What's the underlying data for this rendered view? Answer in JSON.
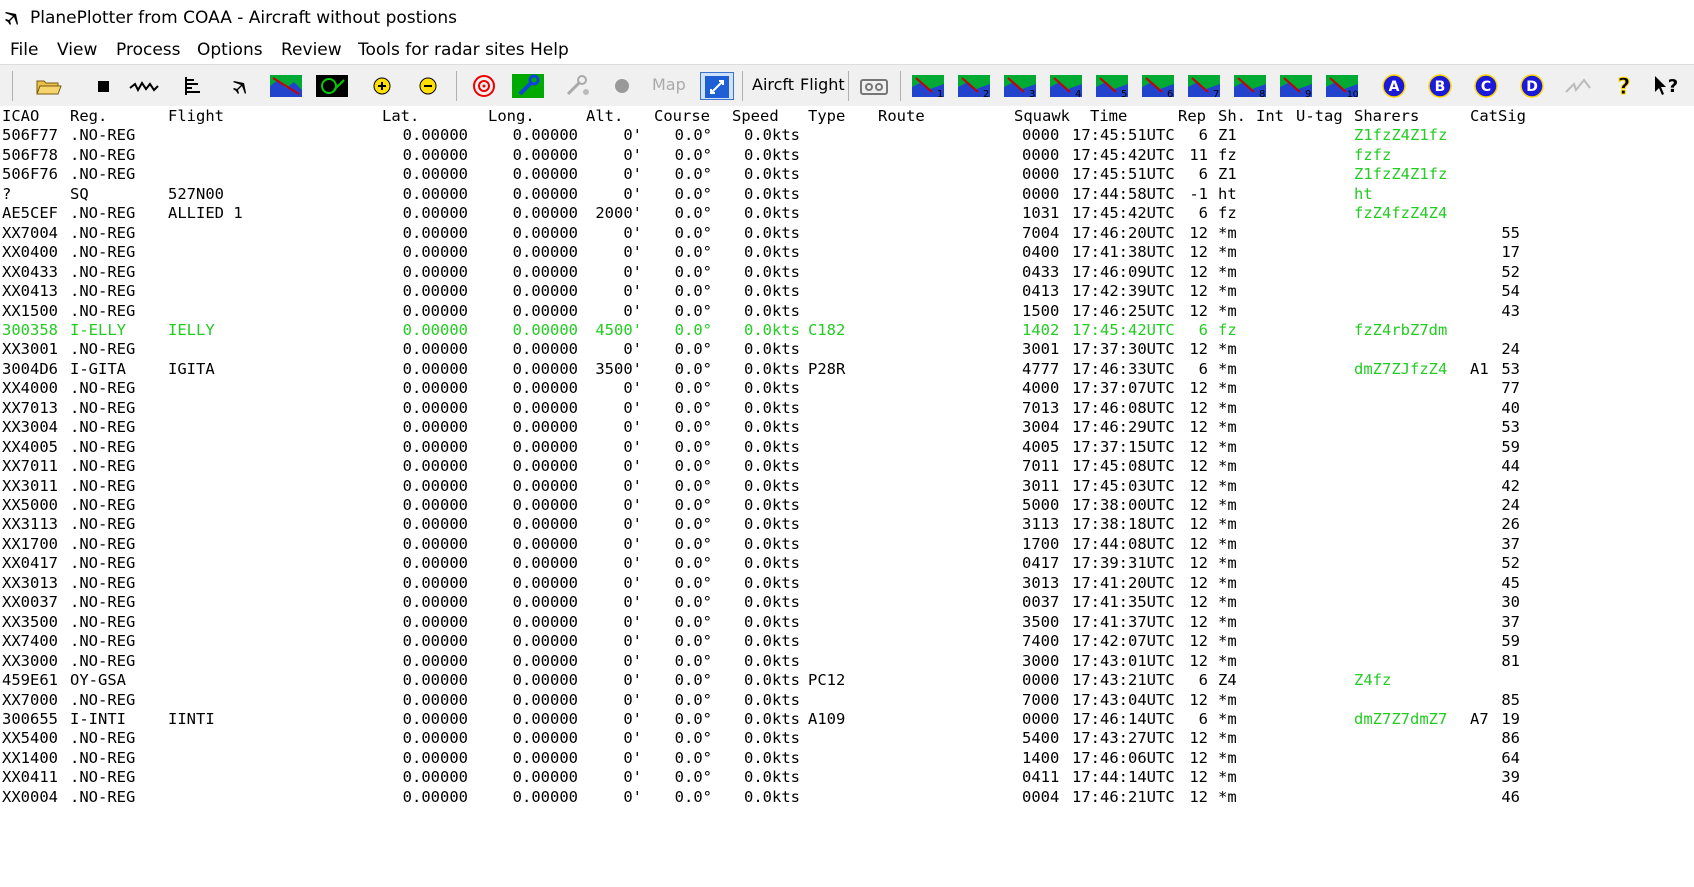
{
  "window": {
    "title": "PlanePlotter from COAA - Aircraft without postions"
  },
  "menu": [
    "File",
    "View",
    "Process",
    "Options",
    "Review",
    "Tools for radar sites",
    "Help"
  ],
  "toolbar": {
    "aircraft_label": "Aircft",
    "flight_label": "Flight",
    "map_label": "Map",
    "chart_numbers": [
      "1",
      "2",
      "3",
      "4",
      "5",
      "6",
      "7",
      "8",
      "9",
      "10"
    ],
    "letter_buttons": [
      "A",
      "B",
      "C",
      "D"
    ],
    "help_label": "?"
  },
  "columns": [
    "ICAO",
    "Reg.",
    "Flight",
    "Lat.",
    "Long.",
    "Alt.",
    "Course",
    "Speed",
    "Type",
    "Route",
    "Squawk",
    "Time",
    "Rep",
    "Sh.",
    "Int",
    "U-tag",
    "Sharers",
    "Cat",
    "Sig"
  ],
  "rows": [
    {
      "icao": "506F77",
      "reg": ".NO-REG",
      "flight": "",
      "lat": "0.00000",
      "lon": "0.00000",
      "alt": "0'",
      "course": "0.0°",
      "speed": "0.0kts",
      "type": "",
      "squawk": "0000",
      "time": "17:45:51UTC",
      "rep": "6",
      "sh": "Z1",
      "sharers": "Z1fzZ4Z1fz",
      "cat": "",
      "sig": "",
      "hl": false
    },
    {
      "icao": "506F78",
      "reg": ".NO-REG",
      "flight": "",
      "lat": "0.00000",
      "lon": "0.00000",
      "alt": "0'",
      "course": "0.0°",
      "speed": "0.0kts",
      "type": "",
      "squawk": "0000",
      "time": "17:45:42UTC",
      "rep": "11",
      "sh": "fz",
      "sharers": "fzfz",
      "cat": "",
      "sig": "",
      "hl": false
    },
    {
      "icao": "506F76",
      "reg": ".NO-REG",
      "flight": "",
      "lat": "0.00000",
      "lon": "0.00000",
      "alt": "0'",
      "course": "0.0°",
      "speed": "0.0kts",
      "type": "",
      "squawk": "0000",
      "time": "17:45:51UTC",
      "rep": "6",
      "sh": "Z1",
      "sharers": "Z1fzZ4Z1fz",
      "cat": "",
      "sig": "",
      "hl": false
    },
    {
      "icao": "?",
      "reg": "SQ",
      "flight": "527N00",
      "lat": "0.00000",
      "lon": "0.00000",
      "alt": "0'",
      "course": "0.0°",
      "speed": "0.0kts",
      "type": "",
      "squawk": "0000",
      "time": "17:44:58UTC",
      "rep": "-1",
      "sh": "ht",
      "sharers": "ht",
      "cat": "",
      "sig": "",
      "hl": false
    },
    {
      "icao": "AE5CEF",
      "reg": ".NO-REG",
      "flight": "ALLIED 1",
      "lat": "0.00000",
      "lon": "0.00000",
      "alt": "2000'",
      "course": "0.0°",
      "speed": "0.0kts",
      "type": "",
      "squawk": "1031",
      "time": "17:45:42UTC",
      "rep": "6",
      "sh": "fz",
      "sharers": "fzZ4fzZ4Z4",
      "cat": "",
      "sig": "",
      "hl": false
    },
    {
      "icao": "XX7004",
      "reg": ".NO-REG",
      "flight": "",
      "lat": "0.00000",
      "lon": "0.00000",
      "alt": "0'",
      "course": "0.0°",
      "speed": "0.0kts",
      "type": "",
      "squawk": "7004",
      "time": "17:46:20UTC",
      "rep": "12",
      "sh": "*m",
      "sharers": "",
      "cat": "",
      "sig": "55",
      "hl": false
    },
    {
      "icao": "XX0400",
      "reg": ".NO-REG",
      "flight": "",
      "lat": "0.00000",
      "lon": "0.00000",
      "alt": "0'",
      "course": "0.0°",
      "speed": "0.0kts",
      "type": "",
      "squawk": "0400",
      "time": "17:41:38UTC",
      "rep": "12",
      "sh": "*m",
      "sharers": "",
      "cat": "",
      "sig": "17",
      "hl": false
    },
    {
      "icao": "XX0433",
      "reg": ".NO-REG",
      "flight": "",
      "lat": "0.00000",
      "lon": "0.00000",
      "alt": "0'",
      "course": "0.0°",
      "speed": "0.0kts",
      "type": "",
      "squawk": "0433",
      "time": "17:46:09UTC",
      "rep": "12",
      "sh": "*m",
      "sharers": "",
      "cat": "",
      "sig": "52",
      "hl": false
    },
    {
      "icao": "XX0413",
      "reg": ".NO-REG",
      "flight": "",
      "lat": "0.00000",
      "lon": "0.00000",
      "alt": "0'",
      "course": "0.0°",
      "speed": "0.0kts",
      "type": "",
      "squawk": "0413",
      "time": "17:42:39UTC",
      "rep": "12",
      "sh": "*m",
      "sharers": "",
      "cat": "",
      "sig": "54",
      "hl": false
    },
    {
      "icao": "XX1500",
      "reg": ".NO-REG",
      "flight": "",
      "lat": "0.00000",
      "lon": "0.00000",
      "alt": "0'",
      "course": "0.0°",
      "speed": "0.0kts",
      "type": "",
      "squawk": "1500",
      "time": "17:46:25UTC",
      "rep": "12",
      "sh": "*m",
      "sharers": "",
      "cat": "",
      "sig": "43",
      "hl": false
    },
    {
      "icao": "300358",
      "reg": "I-ELLY",
      "flight": "IELLY",
      "lat": "0.00000",
      "lon": "0.00000",
      "alt": "4500'",
      "course": "0.0°",
      "speed": "0.0kts",
      "type": "C182",
      "squawk": "1402",
      "time": "17:45:42UTC",
      "rep": "6",
      "sh": "fz",
      "sharers": "fzZ4rbZ7dm",
      "cat": "",
      "sig": "",
      "hl": true
    },
    {
      "icao": "XX3001",
      "reg": ".NO-REG",
      "flight": "",
      "lat": "0.00000",
      "lon": "0.00000",
      "alt": "0'",
      "course": "0.0°",
      "speed": "0.0kts",
      "type": "",
      "squawk": "3001",
      "time": "17:37:30UTC",
      "rep": "12",
      "sh": "*m",
      "sharers": "",
      "cat": "",
      "sig": "24",
      "hl": false
    },
    {
      "icao": "3004D6",
      "reg": "I-GITA",
      "flight": "IGITA",
      "lat": "0.00000",
      "lon": "0.00000",
      "alt": "3500'",
      "course": "0.0°",
      "speed": "0.0kts",
      "type": "P28R",
      "squawk": "4777",
      "time": "17:46:33UTC",
      "rep": "6",
      "sh": "*m",
      "sharers": "dmZ7ZJfzZ4",
      "cat": "A1",
      "sig": "53",
      "hl": false
    },
    {
      "icao": "XX4000",
      "reg": ".NO-REG",
      "flight": "",
      "lat": "0.00000",
      "lon": "0.00000",
      "alt": "0'",
      "course": "0.0°",
      "speed": "0.0kts",
      "type": "",
      "squawk": "4000",
      "time": "17:37:07UTC",
      "rep": "12",
      "sh": "*m",
      "sharers": "",
      "cat": "",
      "sig": "77",
      "hl": false
    },
    {
      "icao": "XX7013",
      "reg": ".NO-REG",
      "flight": "",
      "lat": "0.00000",
      "lon": "0.00000",
      "alt": "0'",
      "course": "0.0°",
      "speed": "0.0kts",
      "type": "",
      "squawk": "7013",
      "time": "17:46:08UTC",
      "rep": "12",
      "sh": "*m",
      "sharers": "",
      "cat": "",
      "sig": "40",
      "hl": false
    },
    {
      "icao": "XX3004",
      "reg": ".NO-REG",
      "flight": "",
      "lat": "0.00000",
      "lon": "0.00000",
      "alt": "0'",
      "course": "0.0°",
      "speed": "0.0kts",
      "type": "",
      "squawk": "3004",
      "time": "17:46:29UTC",
      "rep": "12",
      "sh": "*m",
      "sharers": "",
      "cat": "",
      "sig": "53",
      "hl": false
    },
    {
      "icao": "XX4005",
      "reg": ".NO-REG",
      "flight": "",
      "lat": "0.00000",
      "lon": "0.00000",
      "alt": "0'",
      "course": "0.0°",
      "speed": "0.0kts",
      "type": "",
      "squawk": "4005",
      "time": "17:37:15UTC",
      "rep": "12",
      "sh": "*m",
      "sharers": "",
      "cat": "",
      "sig": "59",
      "hl": false
    },
    {
      "icao": "XX7011",
      "reg": ".NO-REG",
      "flight": "",
      "lat": "0.00000",
      "lon": "0.00000",
      "alt": "0'",
      "course": "0.0°",
      "speed": "0.0kts",
      "type": "",
      "squawk": "7011",
      "time": "17:45:08UTC",
      "rep": "12",
      "sh": "*m",
      "sharers": "",
      "cat": "",
      "sig": "44",
      "hl": false
    },
    {
      "icao": "XX3011",
      "reg": ".NO-REG",
      "flight": "",
      "lat": "0.00000",
      "lon": "0.00000",
      "alt": "0'",
      "course": "0.0°",
      "speed": "0.0kts",
      "type": "",
      "squawk": "3011",
      "time": "17:45:03UTC",
      "rep": "12",
      "sh": "*m",
      "sharers": "",
      "cat": "",
      "sig": "42",
      "hl": false
    },
    {
      "icao": "XX5000",
      "reg": ".NO-REG",
      "flight": "",
      "lat": "0.00000",
      "lon": "0.00000",
      "alt": "0'",
      "course": "0.0°",
      "speed": "0.0kts",
      "type": "",
      "squawk": "5000",
      "time": "17:38:00UTC",
      "rep": "12",
      "sh": "*m",
      "sharers": "",
      "cat": "",
      "sig": "24",
      "hl": false
    },
    {
      "icao": "XX3113",
      "reg": ".NO-REG",
      "flight": "",
      "lat": "0.00000",
      "lon": "0.00000",
      "alt": "0'",
      "course": "0.0°",
      "speed": "0.0kts",
      "type": "",
      "squawk": "3113",
      "time": "17:38:18UTC",
      "rep": "12",
      "sh": "*m",
      "sharers": "",
      "cat": "",
      "sig": "26",
      "hl": false
    },
    {
      "icao": "XX1700",
      "reg": ".NO-REG",
      "flight": "",
      "lat": "0.00000",
      "lon": "0.00000",
      "alt": "0'",
      "course": "0.0°",
      "speed": "0.0kts",
      "type": "",
      "squawk": "1700",
      "time": "17:44:08UTC",
      "rep": "12",
      "sh": "*m",
      "sharers": "",
      "cat": "",
      "sig": "37",
      "hl": false
    },
    {
      "icao": "XX0417",
      "reg": ".NO-REG",
      "flight": "",
      "lat": "0.00000",
      "lon": "0.00000",
      "alt": "0'",
      "course": "0.0°",
      "speed": "0.0kts",
      "type": "",
      "squawk": "0417",
      "time": "17:39:31UTC",
      "rep": "12",
      "sh": "*m",
      "sharers": "",
      "cat": "",
      "sig": "52",
      "hl": false
    },
    {
      "icao": "XX3013",
      "reg": ".NO-REG",
      "flight": "",
      "lat": "0.00000",
      "lon": "0.00000",
      "alt": "0'",
      "course": "0.0°",
      "speed": "0.0kts",
      "type": "",
      "squawk": "3013",
      "time": "17:41:20UTC",
      "rep": "12",
      "sh": "*m",
      "sharers": "",
      "cat": "",
      "sig": "45",
      "hl": false
    },
    {
      "icao": "XX0037",
      "reg": ".NO-REG",
      "flight": "",
      "lat": "0.00000",
      "lon": "0.00000",
      "alt": "0'",
      "course": "0.0°",
      "speed": "0.0kts",
      "type": "",
      "squawk": "0037",
      "time": "17:41:35UTC",
      "rep": "12",
      "sh": "*m",
      "sharers": "",
      "cat": "",
      "sig": "30",
      "hl": false
    },
    {
      "icao": "XX3500",
      "reg": ".NO-REG",
      "flight": "",
      "lat": "0.00000",
      "lon": "0.00000",
      "alt": "0'",
      "course": "0.0°",
      "speed": "0.0kts",
      "type": "",
      "squawk": "3500",
      "time": "17:41:37UTC",
      "rep": "12",
      "sh": "*m",
      "sharers": "",
      "cat": "",
      "sig": "37",
      "hl": false
    },
    {
      "icao": "XX7400",
      "reg": ".NO-REG",
      "flight": "",
      "lat": "0.00000",
      "lon": "0.00000",
      "alt": "0'",
      "course": "0.0°",
      "speed": "0.0kts",
      "type": "",
      "squawk": "7400",
      "time": "17:42:07UTC",
      "rep": "12",
      "sh": "*m",
      "sharers": "",
      "cat": "",
      "sig": "59",
      "hl": false
    },
    {
      "icao": "XX3000",
      "reg": ".NO-REG",
      "flight": "",
      "lat": "0.00000",
      "lon": "0.00000",
      "alt": "0'",
      "course": "0.0°",
      "speed": "0.0kts",
      "type": "",
      "squawk": "3000",
      "time": "17:43:01UTC",
      "rep": "12",
      "sh": "*m",
      "sharers": "",
      "cat": "",
      "sig": "81",
      "hl": false
    },
    {
      "icao": "459E61",
      "reg": "OY-GSA",
      "flight": "",
      "lat": "0.00000",
      "lon": "0.00000",
      "alt": "0'",
      "course": "0.0°",
      "speed": "0.0kts",
      "type": "PC12",
      "squawk": "0000",
      "time": "17:43:21UTC",
      "rep": "6",
      "sh": "Z4",
      "sharers": "Z4fz",
      "cat": "",
      "sig": "",
      "hl": false
    },
    {
      "icao": "XX7000",
      "reg": ".NO-REG",
      "flight": "",
      "lat": "0.00000",
      "lon": "0.00000",
      "alt": "0'",
      "course": "0.0°",
      "speed": "0.0kts",
      "type": "",
      "squawk": "7000",
      "time": "17:43:04UTC",
      "rep": "12",
      "sh": "*m",
      "sharers": "",
      "cat": "",
      "sig": "85",
      "hl": false
    },
    {
      "icao": "300655",
      "reg": "I-INTI",
      "flight": "IINTI",
      "lat": "0.00000",
      "lon": "0.00000",
      "alt": "0'",
      "course": "0.0°",
      "speed": "0.0kts",
      "type": "A109",
      "squawk": "0000",
      "time": "17:46:14UTC",
      "rep": "6",
      "sh": "*m",
      "sharers": "dmZ7Z7dmZ7",
      "cat": "A7",
      "sig": "19",
      "hl": false
    },
    {
      "icao": "XX5400",
      "reg": ".NO-REG",
      "flight": "",
      "lat": "0.00000",
      "lon": "0.00000",
      "alt": "0'",
      "course": "0.0°",
      "speed": "0.0kts",
      "type": "",
      "squawk": "5400",
      "time": "17:43:27UTC",
      "rep": "12",
      "sh": "*m",
      "sharers": "",
      "cat": "",
      "sig": "86",
      "hl": false
    },
    {
      "icao": "XX1400",
      "reg": ".NO-REG",
      "flight": "",
      "lat": "0.00000",
      "lon": "0.00000",
      "alt": "0'",
      "course": "0.0°",
      "speed": "0.0kts",
      "type": "",
      "squawk": "1400",
      "time": "17:46:06UTC",
      "rep": "12",
      "sh": "*m",
      "sharers": "",
      "cat": "",
      "sig": "64",
      "hl": false
    },
    {
      "icao": "XX0411",
      "reg": ".NO-REG",
      "flight": "",
      "lat": "0.00000",
      "lon": "0.00000",
      "alt": "0'",
      "course": "0.0°",
      "speed": "0.0kts",
      "type": "",
      "squawk": "0411",
      "time": "17:44:14UTC",
      "rep": "12",
      "sh": "*m",
      "sharers": "",
      "cat": "",
      "sig": "39",
      "hl": false
    },
    {
      "icao": "XX0004",
      "reg": ".NO-REG",
      "flight": "",
      "lat": "0.00000",
      "lon": "0.00000",
      "alt": "0'",
      "course": "0.0°",
      "speed": "0.0kts",
      "type": "",
      "squawk": "0004",
      "time": "17:46:21UTC",
      "rep": "12",
      "sh": "*m",
      "sharers": "",
      "cat": "",
      "sig": "46",
      "hl": false
    }
  ],
  "colors": {
    "highlight": "#22cc22",
    "sharers": "#22cc22",
    "toolbar_bg": "#f0f0f0"
  }
}
